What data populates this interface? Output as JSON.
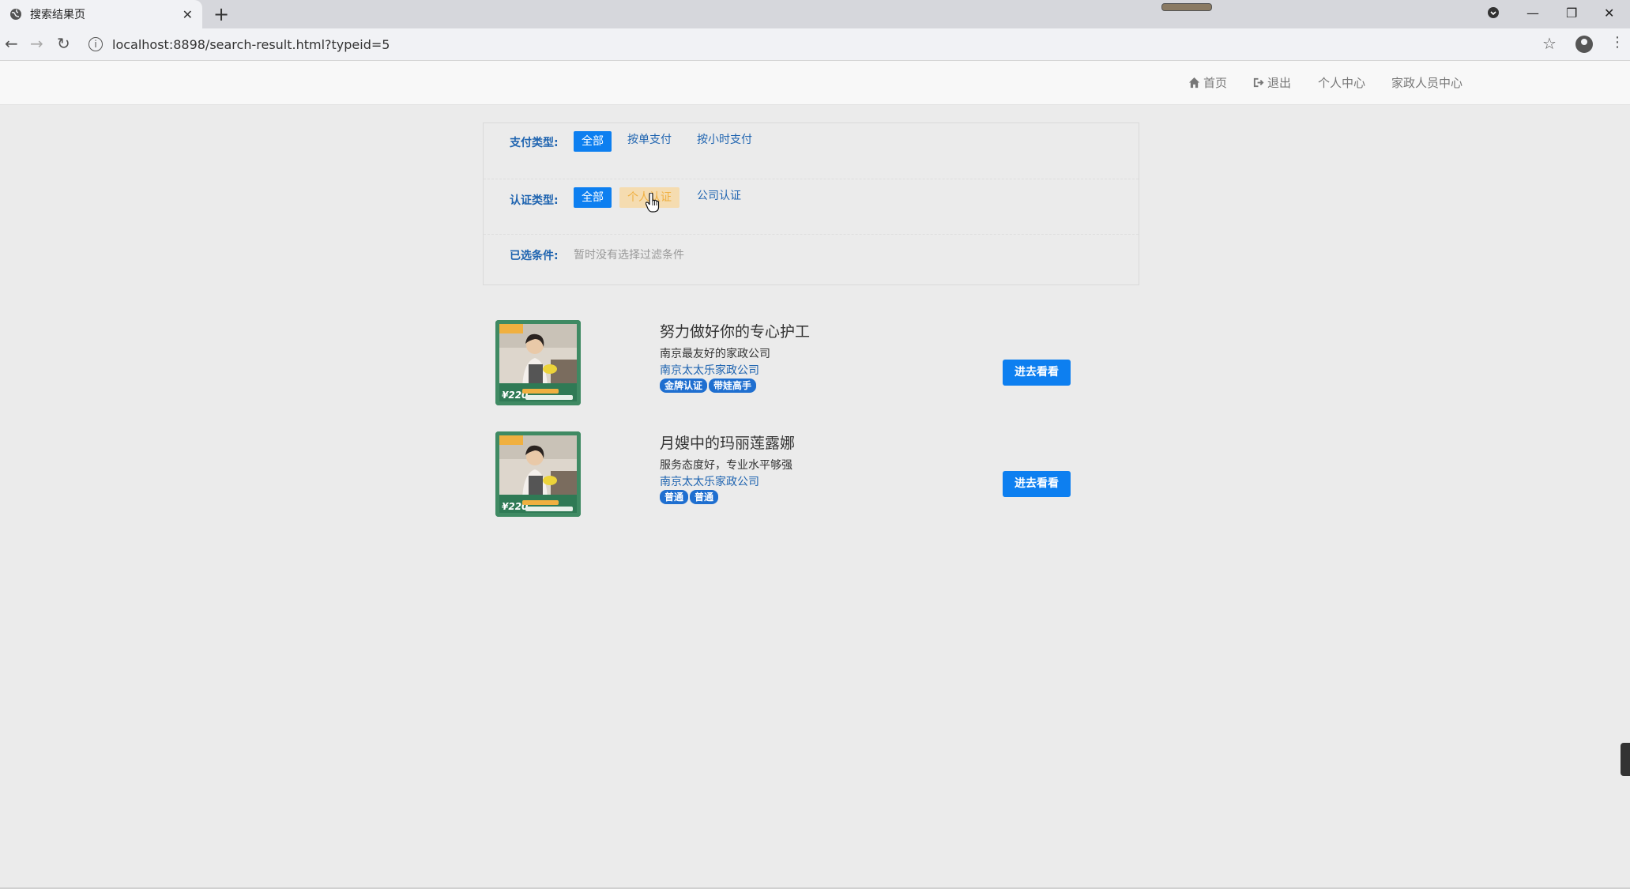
{
  "browser": {
    "tab_title": "搜索结果页",
    "url": "localhost:8898/search-result.html?typeid=5"
  },
  "nav": {
    "home": "首页",
    "logout": "退出",
    "personal_center": "个人中心",
    "staff_center": "家政人员中心"
  },
  "filters": {
    "pay_type": {
      "label": "支付类型:",
      "options": [
        "全部",
        "按单支付",
        "按小时支付"
      ],
      "selected": "全部"
    },
    "cert_type": {
      "label": "认证类型:",
      "options": [
        "全部",
        "个人认证",
        "公司认证"
      ],
      "selected": "全部",
      "hovered": "个人认证"
    },
    "selected_conditions": {
      "label": "已选条件:",
      "empty_text": "暂时没有选择过滤条件"
    }
  },
  "results": [
    {
      "name": "努力做好你的专心护工",
      "desc": "南京最友好的家政公司",
      "company": "南京太太乐家政公司",
      "badges": [
        "金牌认证",
        "带娃高手"
      ],
      "thumb_price": "220",
      "button": "进去看看"
    },
    {
      "name": "月嫂中的玛丽莲露娜",
      "desc": "服务态度好，专业水平够强",
      "company": "南京太太乐家政公司",
      "badges": [
        "普通",
        "普通"
      ],
      "thumb_price": "220",
      "button": "进去看看"
    }
  ],
  "colors": {
    "primary": "#0d7ff0",
    "link": "#1f64b0",
    "hover_bg": "#f5dcb0",
    "page_bg": "#ebebeb"
  }
}
